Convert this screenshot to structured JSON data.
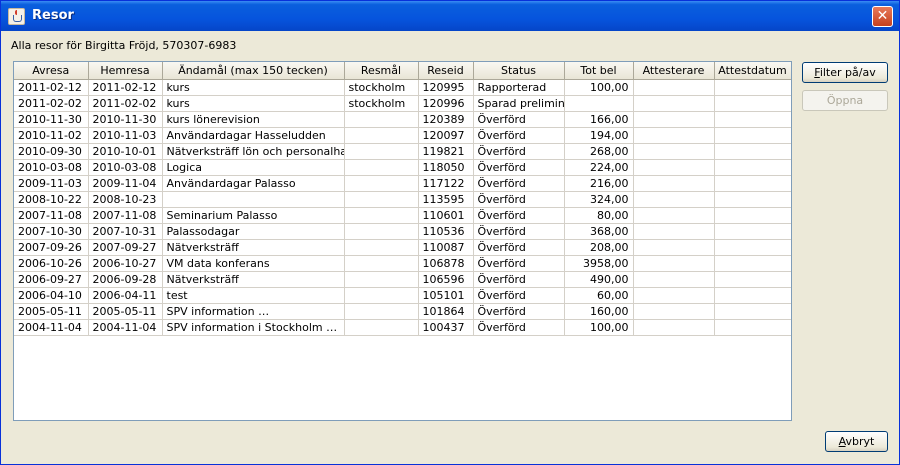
{
  "window": {
    "title": "Resor",
    "close_label": "✕"
  },
  "subtitle": "Alla resor för Birgitta Fröjd, 570307-6983",
  "table": {
    "columns": [
      "Avresa",
      "Hemresa",
      "Ändamål (max 150 tecken)",
      "Resmål",
      "Reseid",
      "Status",
      "Tot bel",
      "Attesterare",
      "Attestdatum"
    ],
    "rows": [
      [
        "2011-02-12",
        "2011-02-12",
        "kurs",
        "stockholm",
        "120995",
        "Rapporterad",
        "100,00",
        "",
        ""
      ],
      [
        "2011-02-02",
        "2011-02-02",
        "kurs",
        "stockholm",
        "120996",
        "Sparad preliminärt",
        "",
        "",
        ""
      ],
      [
        "2010-11-30",
        "2010-11-30",
        "kurs lönerevision",
        "",
        "120389",
        "Överförd",
        "166,00",
        "",
        ""
      ],
      [
        "2010-11-02",
        "2010-11-03",
        "Användardagar Hasseludden",
        "",
        "120097",
        "Överförd",
        "194,00",
        "",
        ""
      ],
      [
        "2010-09-30",
        "2010-10-01",
        "Nätverksträff lön och personalhan…",
        "",
        "119821",
        "Överförd",
        "268,00",
        "",
        ""
      ],
      [
        "2010-03-08",
        "2010-03-08",
        "Logica",
        "",
        "118050",
        "Överförd",
        "224,00",
        "",
        ""
      ],
      [
        "2009-11-03",
        "2009-11-04",
        "Användardagar Palasso",
        "",
        "117122",
        "Överförd",
        "216,00",
        "",
        ""
      ],
      [
        "2008-10-22",
        "2008-10-23",
        "",
        "",
        "113595",
        "Överförd",
        "324,00",
        "",
        ""
      ],
      [
        "2007-11-08",
        "2007-11-08",
        "Seminarium Palasso",
        "",
        "110601",
        "Överförd",
        "80,00",
        "",
        ""
      ],
      [
        "2007-10-30",
        "2007-10-31",
        "Palassodagar",
        "",
        "110536",
        "Överförd",
        "368,00",
        "",
        ""
      ],
      [
        "2007-09-26",
        "2007-09-27",
        "Nätverksträff",
        "",
        "110087",
        "Överförd",
        "208,00",
        "",
        ""
      ],
      [
        "2006-10-26",
        "2006-10-27",
        "VM data konferans",
        "",
        "106878",
        "Överförd",
        "3958,00",
        "",
        ""
      ],
      [
        "2006-09-27",
        "2006-09-28",
        "Nätverksträff",
        "",
        "106596",
        "Överförd",
        "490,00",
        "",
        ""
      ],
      [
        "2006-04-10",
        "2006-04-11",
        "test",
        "",
        "105101",
        "Överförd",
        "60,00",
        "",
        ""
      ],
      [
        "2005-05-11",
        "2005-05-11",
        "SPV information …",
        "",
        "101864",
        "Överförd",
        "160,00",
        "",
        ""
      ],
      [
        "2004-11-04",
        "2004-11-04",
        "SPV information i Stockholm …",
        "",
        "100437",
        "Överförd",
        "100,00",
        "",
        ""
      ]
    ]
  },
  "buttons": {
    "filter": {
      "mnemonic": "F",
      "rest": "ilter på/av"
    },
    "open": "Öppna",
    "cancel": {
      "mnemonic": "A",
      "rest": "vbryt"
    }
  }
}
